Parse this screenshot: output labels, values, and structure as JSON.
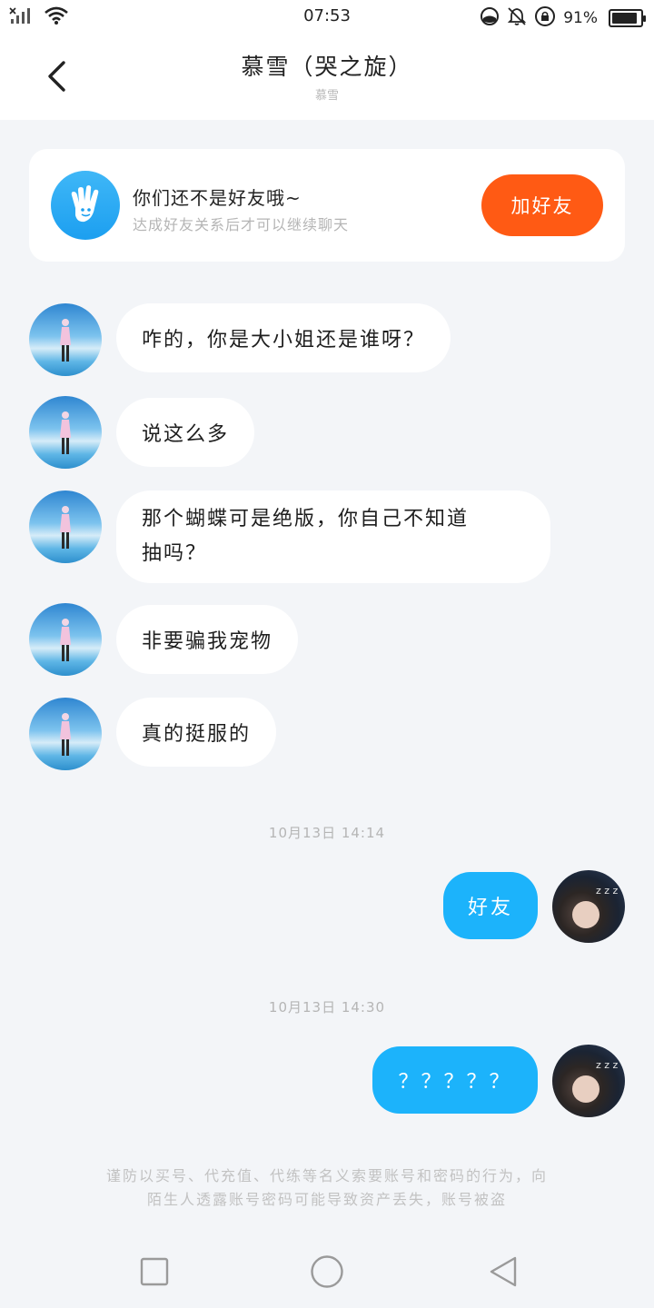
{
  "status_bar": {
    "time": "07:53",
    "battery_percent_text": "91%",
    "battery_level": 0.91,
    "icons": [
      "signal-off-icon",
      "wifi-icon",
      "data-saver-icon",
      "mute-icon",
      "lock-rotation-icon",
      "battery-icon"
    ]
  },
  "header": {
    "title": "慕雪（哭之旋）",
    "subtitle": "慕雪"
  },
  "friend_card": {
    "title": "你们还不是好友哦~",
    "subtitle": "达成好友关系后才可以继续聊天",
    "button_label": "加好友",
    "icon": "hand-icon"
  },
  "messages_in": [
    {
      "text": "咋的，你是大小姐还是谁呀？"
    },
    {
      "text": "说这么多"
    },
    {
      "text_line1": "那个蝴蝶可是绝版，你自己不知道",
      "text_line2": "抽吗？"
    },
    {
      "text": "非要骗我宠物"
    },
    {
      "text": "真的挺服的"
    }
  ],
  "timestamps": [
    "10月13日 14:14",
    "10月13日 14:30"
  ],
  "messages_out": [
    {
      "text": "好友"
    },
    {
      "text": "？？？？？"
    }
  ],
  "warning": {
    "line1": "谨防以买号、代充值、代练等名义索要账号和密码的行为，向",
    "line2": "陌生人透露账号密码可能导致资产丢失，账号被盗"
  },
  "colors": {
    "accent_orange": "#ff5a14",
    "accent_blue": "#1cb3fb",
    "background": "#f3f5f8"
  }
}
